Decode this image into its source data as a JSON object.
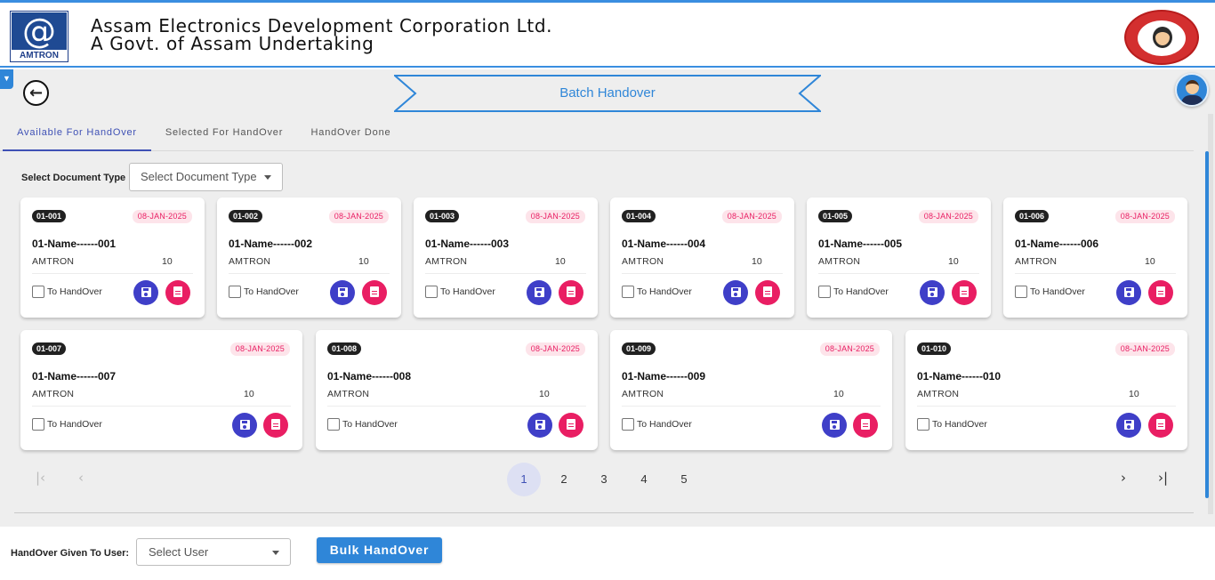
{
  "header": {
    "logo_text": "AMTRON",
    "logo_symbol": "@",
    "title": "Assam Electronics Development Corporation Ltd.",
    "subtitle": "A Govt. of Assam Undertaking",
    "emblem_icon": "beti-bachao-emblem"
  },
  "page": {
    "title": "Batch Handover",
    "back_icon": "arrow-left-icon",
    "accent_color": "#2f86d8"
  },
  "tabs": [
    {
      "label": "Available For HandOver",
      "active": true
    },
    {
      "label": "Selected For HandOver",
      "active": false
    },
    {
      "label": "HandOver Done",
      "active": false
    }
  ],
  "filter": {
    "label": "Select Document Type",
    "placeholder": "Select Document Type"
  },
  "cards": [
    {
      "code": "01-001",
      "date": "08-JAN-2025",
      "name": "01-Name------001",
      "org": "AMTRON",
      "qty": "10",
      "checkbox_label": "To HandOver"
    },
    {
      "code": "01-002",
      "date": "08-JAN-2025",
      "name": "01-Name------002",
      "org": "AMTRON",
      "qty": "10",
      "checkbox_label": "To HandOver"
    },
    {
      "code": "01-003",
      "date": "08-JAN-2025",
      "name": "01-Name------003",
      "org": "AMTRON",
      "qty": "10",
      "checkbox_label": "To HandOver"
    },
    {
      "code": "01-004",
      "date": "08-JAN-2025",
      "name": "01-Name------004",
      "org": "AMTRON",
      "qty": "10",
      "checkbox_label": "To HandOver"
    },
    {
      "code": "01-005",
      "date": "08-JAN-2025",
      "name": "01-Name------005",
      "org": "AMTRON",
      "qty": "10",
      "checkbox_label": "To HandOver"
    },
    {
      "code": "01-006",
      "date": "08-JAN-2025",
      "name": "01-Name------006",
      "org": "AMTRON",
      "qty": "10",
      "checkbox_label": "To HandOver"
    },
    {
      "code": "01-007",
      "date": "08-JAN-2025",
      "name": "01-Name------007",
      "org": "AMTRON",
      "qty": "10",
      "checkbox_label": "To HandOver"
    },
    {
      "code": "01-008",
      "date": "08-JAN-2025",
      "name": "01-Name------008",
      "org": "AMTRON",
      "qty": "10",
      "checkbox_label": "To HandOver"
    },
    {
      "code": "01-009",
      "date": "08-JAN-2025",
      "name": "01-Name------009",
      "org": "AMTRON",
      "qty": "10",
      "checkbox_label": "To HandOver"
    },
    {
      "code": "01-010",
      "date": "08-JAN-2025",
      "name": "01-Name------010",
      "org": "AMTRON",
      "qty": "10",
      "checkbox_label": "To HandOver"
    }
  ],
  "pagination": {
    "first_icon": "first-page-icon",
    "prev_icon": "chevron-left-icon",
    "next_icon": "chevron-right-icon",
    "last_icon": "last-page-icon",
    "pages": [
      "1",
      "2",
      "3",
      "4",
      "5"
    ],
    "current": "1"
  },
  "footer": {
    "user_label": "HandOver Given To User:",
    "user_placeholder": "Select User",
    "bulk_button": "Bulk HandOver"
  }
}
